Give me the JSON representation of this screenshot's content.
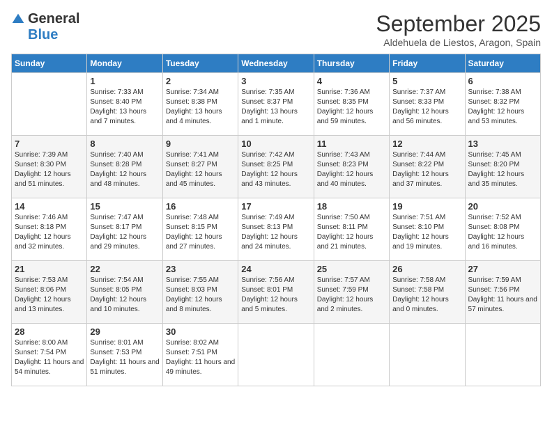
{
  "header": {
    "logo_general": "General",
    "logo_blue": "Blue",
    "month": "September 2025",
    "location": "Aldehuela de Liestos, Aragon, Spain"
  },
  "days_of_week": [
    "Sunday",
    "Monday",
    "Tuesday",
    "Wednesday",
    "Thursday",
    "Friday",
    "Saturday"
  ],
  "weeks": [
    [
      {
        "day": "",
        "sunrise": "",
        "sunset": "",
        "daylight": ""
      },
      {
        "day": "1",
        "sunrise": "Sunrise: 7:33 AM",
        "sunset": "Sunset: 8:40 PM",
        "daylight": "Daylight: 13 hours and 7 minutes."
      },
      {
        "day": "2",
        "sunrise": "Sunrise: 7:34 AM",
        "sunset": "Sunset: 8:38 PM",
        "daylight": "Daylight: 13 hours and 4 minutes."
      },
      {
        "day": "3",
        "sunrise": "Sunrise: 7:35 AM",
        "sunset": "Sunset: 8:37 PM",
        "daylight": "Daylight: 13 hours and 1 minute."
      },
      {
        "day": "4",
        "sunrise": "Sunrise: 7:36 AM",
        "sunset": "Sunset: 8:35 PM",
        "daylight": "Daylight: 12 hours and 59 minutes."
      },
      {
        "day": "5",
        "sunrise": "Sunrise: 7:37 AM",
        "sunset": "Sunset: 8:33 PM",
        "daylight": "Daylight: 12 hours and 56 minutes."
      },
      {
        "day": "6",
        "sunrise": "Sunrise: 7:38 AM",
        "sunset": "Sunset: 8:32 PM",
        "daylight": "Daylight: 12 hours and 53 minutes."
      }
    ],
    [
      {
        "day": "7",
        "sunrise": "Sunrise: 7:39 AM",
        "sunset": "Sunset: 8:30 PM",
        "daylight": "Daylight: 12 hours and 51 minutes."
      },
      {
        "day": "8",
        "sunrise": "Sunrise: 7:40 AM",
        "sunset": "Sunset: 8:28 PM",
        "daylight": "Daylight: 12 hours and 48 minutes."
      },
      {
        "day": "9",
        "sunrise": "Sunrise: 7:41 AM",
        "sunset": "Sunset: 8:27 PM",
        "daylight": "Daylight: 12 hours and 45 minutes."
      },
      {
        "day": "10",
        "sunrise": "Sunrise: 7:42 AM",
        "sunset": "Sunset: 8:25 PM",
        "daylight": "Daylight: 12 hours and 43 minutes."
      },
      {
        "day": "11",
        "sunrise": "Sunrise: 7:43 AM",
        "sunset": "Sunset: 8:23 PM",
        "daylight": "Daylight: 12 hours and 40 minutes."
      },
      {
        "day": "12",
        "sunrise": "Sunrise: 7:44 AM",
        "sunset": "Sunset: 8:22 PM",
        "daylight": "Daylight: 12 hours and 37 minutes."
      },
      {
        "day": "13",
        "sunrise": "Sunrise: 7:45 AM",
        "sunset": "Sunset: 8:20 PM",
        "daylight": "Daylight: 12 hours and 35 minutes."
      }
    ],
    [
      {
        "day": "14",
        "sunrise": "Sunrise: 7:46 AM",
        "sunset": "Sunset: 8:18 PM",
        "daylight": "Daylight: 12 hours and 32 minutes."
      },
      {
        "day": "15",
        "sunrise": "Sunrise: 7:47 AM",
        "sunset": "Sunset: 8:17 PM",
        "daylight": "Daylight: 12 hours and 29 minutes."
      },
      {
        "day": "16",
        "sunrise": "Sunrise: 7:48 AM",
        "sunset": "Sunset: 8:15 PM",
        "daylight": "Daylight: 12 hours and 27 minutes."
      },
      {
        "day": "17",
        "sunrise": "Sunrise: 7:49 AM",
        "sunset": "Sunset: 8:13 PM",
        "daylight": "Daylight: 12 hours and 24 minutes."
      },
      {
        "day": "18",
        "sunrise": "Sunrise: 7:50 AM",
        "sunset": "Sunset: 8:11 PM",
        "daylight": "Daylight: 12 hours and 21 minutes."
      },
      {
        "day": "19",
        "sunrise": "Sunrise: 7:51 AM",
        "sunset": "Sunset: 8:10 PM",
        "daylight": "Daylight: 12 hours and 19 minutes."
      },
      {
        "day": "20",
        "sunrise": "Sunrise: 7:52 AM",
        "sunset": "Sunset: 8:08 PM",
        "daylight": "Daylight: 12 hours and 16 minutes."
      }
    ],
    [
      {
        "day": "21",
        "sunrise": "Sunrise: 7:53 AM",
        "sunset": "Sunset: 8:06 PM",
        "daylight": "Daylight: 12 hours and 13 minutes."
      },
      {
        "day": "22",
        "sunrise": "Sunrise: 7:54 AM",
        "sunset": "Sunset: 8:05 PM",
        "daylight": "Daylight: 12 hours and 10 minutes."
      },
      {
        "day": "23",
        "sunrise": "Sunrise: 7:55 AM",
        "sunset": "Sunset: 8:03 PM",
        "daylight": "Daylight: 12 hours and 8 minutes."
      },
      {
        "day": "24",
        "sunrise": "Sunrise: 7:56 AM",
        "sunset": "Sunset: 8:01 PM",
        "daylight": "Daylight: 12 hours and 5 minutes."
      },
      {
        "day": "25",
        "sunrise": "Sunrise: 7:57 AM",
        "sunset": "Sunset: 7:59 PM",
        "daylight": "Daylight: 12 hours and 2 minutes."
      },
      {
        "day": "26",
        "sunrise": "Sunrise: 7:58 AM",
        "sunset": "Sunset: 7:58 PM",
        "daylight": "Daylight: 12 hours and 0 minutes."
      },
      {
        "day": "27",
        "sunrise": "Sunrise: 7:59 AM",
        "sunset": "Sunset: 7:56 PM",
        "daylight": "Daylight: 11 hours and 57 minutes."
      }
    ],
    [
      {
        "day": "28",
        "sunrise": "Sunrise: 8:00 AM",
        "sunset": "Sunset: 7:54 PM",
        "daylight": "Daylight: 11 hours and 54 minutes."
      },
      {
        "day": "29",
        "sunrise": "Sunrise: 8:01 AM",
        "sunset": "Sunset: 7:53 PM",
        "daylight": "Daylight: 11 hours and 51 minutes."
      },
      {
        "day": "30",
        "sunrise": "Sunrise: 8:02 AM",
        "sunset": "Sunset: 7:51 PM",
        "daylight": "Daylight: 11 hours and 49 minutes."
      },
      {
        "day": "",
        "sunrise": "",
        "sunset": "",
        "daylight": ""
      },
      {
        "day": "",
        "sunrise": "",
        "sunset": "",
        "daylight": ""
      },
      {
        "day": "",
        "sunrise": "",
        "sunset": "",
        "daylight": ""
      },
      {
        "day": "",
        "sunrise": "",
        "sunset": "",
        "daylight": ""
      }
    ]
  ]
}
